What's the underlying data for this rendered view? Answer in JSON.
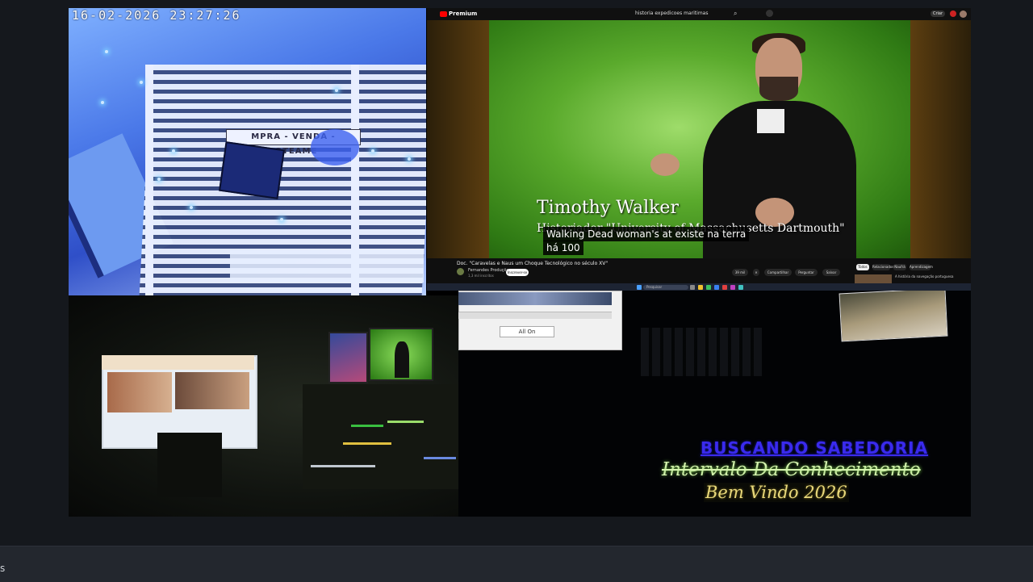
{
  "camera": {
    "timestamp": "16-02-2026  23:27:26",
    "sign_text": "MPRA - VENDA - LOTEAME"
  },
  "youtube": {
    "logo": "Premium",
    "search_query": "historia expedicoes maritimas",
    "create_label": "Criar",
    "lower_third_name": "Timothy Walker",
    "lower_third_role": "Historiador \"University of Massachusetts Dartmouth\"",
    "caption_line1": "Walking Dead woman's at existe na terra",
    "caption_line2": "há 100",
    "video_title": "Doc. \"Caravelas e Naus um Choque Tecnológico no século XV\"",
    "channel_name": "Fernandes Produções",
    "channel_subs": "1,3 mil inscritos",
    "subscribe_label": "Inscrever-se",
    "actions": [
      "39 mil",
      "Compartilhar",
      "Perguntar",
      "Salvar"
    ],
    "chips": [
      "Todos",
      "Relacionados",
      "Naufrá",
      "Aprendizagem"
    ],
    "related_text": "A história da navegação portuguesa",
    "taskbar_search": "Pesquisar"
  },
  "dialog": {
    "all_on_label": "All On"
  },
  "overlay": {
    "line1": "BUSCANDO  SABEDORIA",
    "line2": "Intervalo Da Conhecimento",
    "line3": "Bem Vindo 2026"
  },
  "statusbar": {
    "left_text": "s"
  }
}
